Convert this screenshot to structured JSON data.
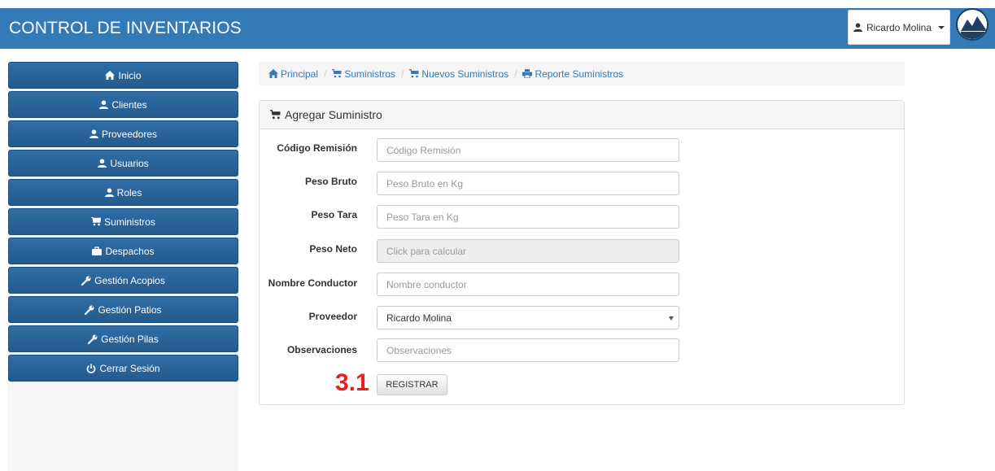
{
  "header": {
    "brand": "CONTROL DE INVENTARIOS",
    "user_name": "Ricardo Molina",
    "accent_color": "#337ab7"
  },
  "sidebar": {
    "items": [
      {
        "label": "Inicio",
        "icon": "home-icon"
      },
      {
        "label": "Clientes",
        "icon": "user-icon"
      },
      {
        "label": "Proveedores",
        "icon": "user-icon"
      },
      {
        "label": "Usuarios",
        "icon": "user-icon"
      },
      {
        "label": "Roles",
        "icon": "user-icon"
      },
      {
        "label": "Suministros",
        "icon": "cart-icon"
      },
      {
        "label": "Despachos",
        "icon": "briefcase-icon"
      },
      {
        "label": "Gestión Acopios",
        "icon": "wrench-icon"
      },
      {
        "label": "Gestión Patios",
        "icon": "wrench-icon"
      },
      {
        "label": "Gestión Pilas",
        "icon": "wrench-icon"
      },
      {
        "label": "Cerrar Sesión",
        "icon": "power-icon"
      }
    ]
  },
  "breadcrumb": {
    "items": [
      {
        "label": "Principal",
        "icon": "home-icon"
      },
      {
        "label": "Suministros",
        "icon": "cart-icon"
      },
      {
        "label": "Nuevos Suministros",
        "icon": "cart-icon"
      },
      {
        "label": "Reporte Suministros",
        "icon": "print-icon"
      }
    ]
  },
  "panel": {
    "title": "Agregar Suministro",
    "fields": [
      {
        "label": "Código Remisión",
        "placeholder": "Código Remisión"
      },
      {
        "label": "Peso Bruto",
        "placeholder": "Peso Bruto en Kg"
      },
      {
        "label": "Peso Tara",
        "placeholder": "Peso Tara en Kg"
      },
      {
        "label": "Peso Neto",
        "placeholder": "Click para calcular"
      },
      {
        "label": "Nombre Conductor",
        "placeholder": "Nombre conductor"
      },
      {
        "label": "Proveedor",
        "value": "Ricardo Molina"
      },
      {
        "label": "Observaciones",
        "placeholder": "Observaciones"
      }
    ],
    "submit_label": "REGISTRAR"
  },
  "annotation": {
    "label": "3.1",
    "color": "#e82020"
  }
}
